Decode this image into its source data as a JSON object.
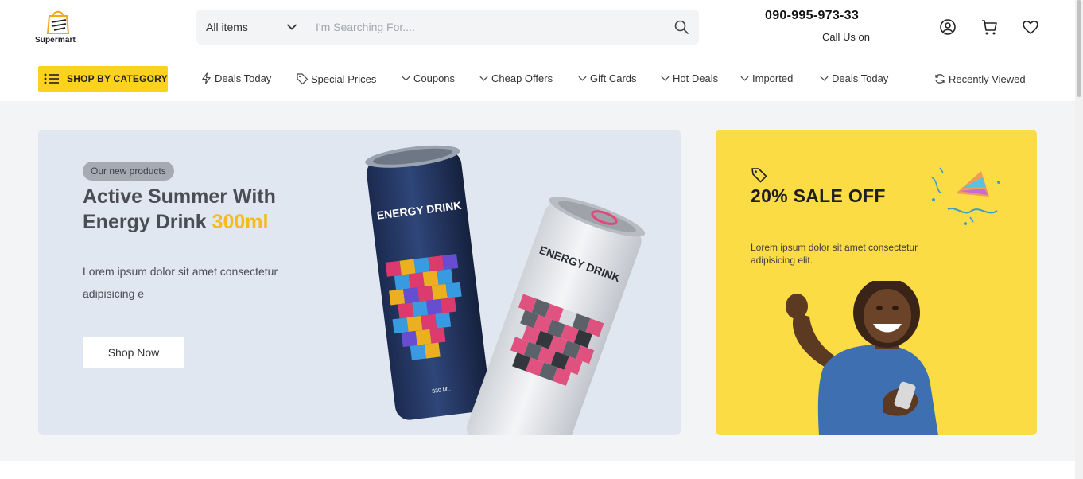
{
  "header": {
    "logo_text": "Supermart",
    "search": {
      "category": "All items",
      "placeholder": "I'm Searching For...."
    },
    "phone": "090-995-973-33",
    "call_label": "Call Us on"
  },
  "nav": {
    "shop_by_category": "SHOP BY CATEGORY",
    "items": [
      {
        "label": "Deals Today",
        "icon": "bolt-icon"
      },
      {
        "label": "Special Prices",
        "icon": "tag-icon"
      },
      {
        "label": "Coupons",
        "icon": "chevron-down-icon"
      },
      {
        "label": "Cheap Offers",
        "icon": "chevron-down-icon"
      },
      {
        "label": "Gift Cards",
        "icon": "chevron-down-icon"
      },
      {
        "label": "Hot Deals",
        "icon": "chevron-down-icon"
      },
      {
        "label": "Imported",
        "icon": "chevron-down-icon"
      },
      {
        "label": "Deals Today",
        "icon": "chevron-down-icon"
      }
    ],
    "recently_viewed": "Recently Viewed"
  },
  "hero": {
    "badge": "Our new products",
    "title_main": "Active Summer With Energy Drink",
    "title_highlight": "300ml",
    "description": "Lorem ipsum dolor sit amet consectetur adipisicing e",
    "button": "Shop Now",
    "can_text": "ENERGY DRINK",
    "can_volume": "330 ML"
  },
  "promo": {
    "title": "20% SALE OFF",
    "description": "Lorem ipsum dolor sit amet consectetur adipisicing elit."
  },
  "colors": {
    "accent": "#fcd21d",
    "highlight": "#f4bb1b",
    "hero_bg": "#e1e7f0",
    "promo_bg": "#fbdc45",
    "page_bg": "#f3f4f6"
  }
}
